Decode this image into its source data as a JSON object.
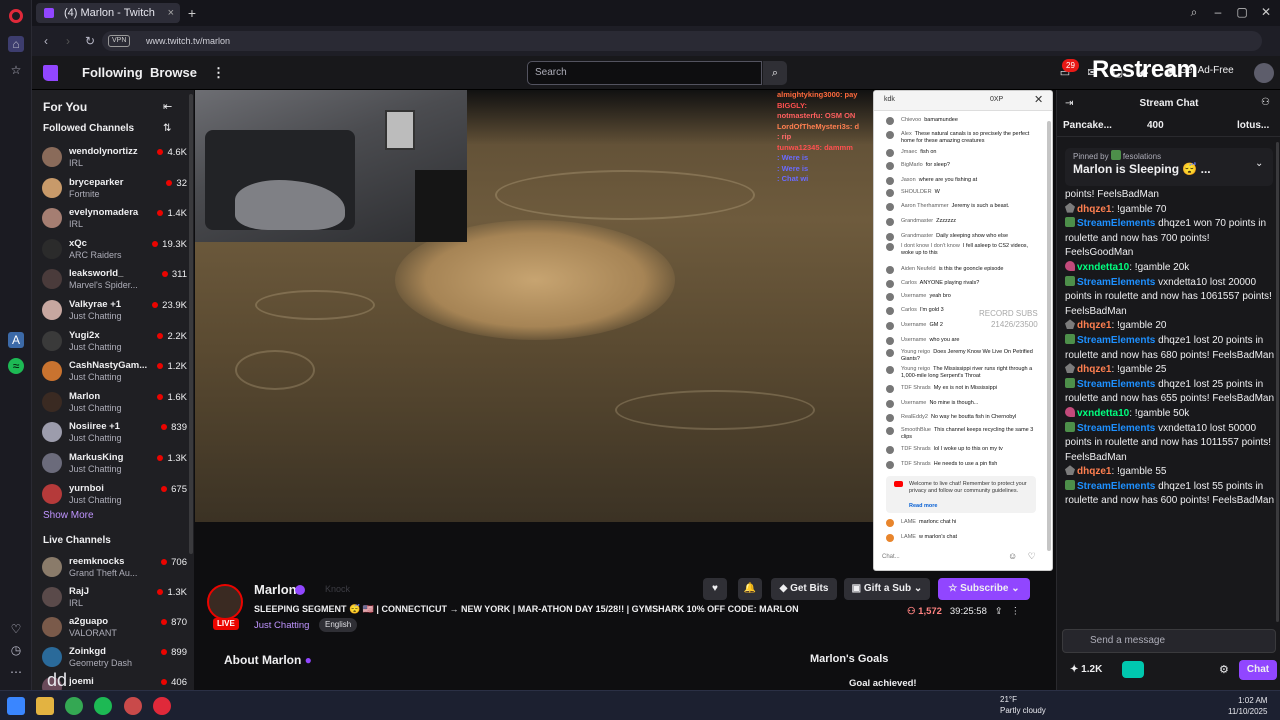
{
  "browser": {
    "tab_title": "(4) Marlon - Twitch",
    "new_tab": "+",
    "vpn": "VPN",
    "url": "www.twitch.tv/marlon"
  },
  "topnav": {
    "following": "Following",
    "browse": "Browse",
    "more": "⋮",
    "search_placeholder": "Search",
    "notification_count": "29",
    "get_adfree": "Get Ad-Free",
    "restream_logo": "Restream"
  },
  "sidebar": {
    "for_you": "For You",
    "followed_header": "Followed Channels",
    "show_more": "Show More",
    "live_channels_header": "Live Channels",
    "followed": [
      {
        "name": "wendolynortizz",
        "game": "IRL",
        "viewers": "4.6K",
        "color": "#8a6b5a"
      },
      {
        "name": "bryceparker",
        "game": "Fortnite",
        "viewers": "32",
        "color": "#c89a6a"
      },
      {
        "name": "evelynomadera",
        "game": "IRL",
        "viewers": "1.4K",
        "color": "#a57e72"
      },
      {
        "name": "xQc",
        "game": "ARC Raiders",
        "viewers": "19.3K",
        "color": "#2b2b2b"
      },
      {
        "name": "leaksworld_",
        "game": "Marvel's Spider...",
        "viewers": "311",
        "color": "#4a3b3b"
      },
      {
        "name": "Valkyrae +1",
        "game": "Just Chatting",
        "viewers": "23.9K",
        "color": "#c7a7a0"
      },
      {
        "name": "Yugi2x",
        "game": "Just Chatting",
        "viewers": "2.2K",
        "color": "#3a3a3a"
      },
      {
        "name": "CashNastyGam...",
        "game": "Just Chatting",
        "viewers": "1.2K",
        "color": "#c9732f"
      },
      {
        "name": "Marlon",
        "game": "Just Chatting",
        "viewers": "1.6K",
        "color": "#3a2a22"
      },
      {
        "name": "Nosiiree +1",
        "game": "Just Chatting",
        "viewers": "839",
        "color": "#9c9cac"
      },
      {
        "name": "MarkusKing",
        "game": "Just Chatting",
        "viewers": "1.3K",
        "color": "#6b6b7b"
      },
      {
        "name": "yurnboi",
        "game": "Just Chatting",
        "viewers": "675",
        "color": "#b53a3a"
      }
    ],
    "live": [
      {
        "name": "reemknocks",
        "game": "Grand Theft Au...",
        "viewers": "706",
        "color": "#8a7b6a"
      },
      {
        "name": "RajJ",
        "game": "IRL",
        "viewers": "1.3K",
        "color": "#5a4a4a"
      },
      {
        "name": "a2guapo",
        "game": "VALORANT",
        "viewers": "870",
        "color": "#7a5a4a"
      },
      {
        "name": "Zoinkgd",
        "game": "Geometry Dash",
        "viewers": "899",
        "color": "#2a6a9a"
      },
      {
        "name": "joemi",
        "game": "",
        "viewers": "406",
        "color": "#6a4a5a"
      }
    ]
  },
  "overlay_chat": [
    {
      "text": "almightyking3000: pay",
      "color": "#ff6a3d"
    },
    {
      "text": "BIGGLY:",
      "color": "#ff4f4f"
    },
    {
      "text": "notmasterfu: OSM ON",
      "color": "#ff5f5f"
    },
    {
      "text": "LordOfTheMysteri3s: d",
      "color": "#ff7f50"
    },
    {
      "text": ": rip",
      "color": "#ff6a6a"
    },
    {
      "text": "tunwa12345: dammm",
      "color": "#ff5050"
    },
    {
      "text": ": Were is",
      "color": "#6a6aff"
    },
    {
      "text": ": Were is",
      "color": "#6a6aff"
    },
    {
      "text": ": Chat wi",
      "color": "#6a6aff"
    }
  ],
  "popup_chat": {
    "header": "kdk",
    "header_right": "0XP",
    "close": "✕",
    "record_subs": "RECORD SUBS",
    "record_value": "21426/23500",
    "messages": [
      {
        "user": "Chievoo",
        "text": "bamamundee"
      },
      {
        "user": "Alex",
        "text": "These natural canals is so precisely the perfect home for these amazing creatures"
      },
      {
        "user": "Jmaec",
        "text": "fish on"
      },
      {
        "user": "BigMarlo",
        "text": "for sleep?"
      },
      {
        "user": "Jason",
        "text": "where are you fishing at"
      },
      {
        "user": "SHOULDER",
        "text": "W"
      },
      {
        "user": "Aaron Therhammer",
        "text": "Jeremy is such a beast."
      },
      {
        "user": "Grandmaster",
        "text": "Zzzzzzz"
      },
      {
        "user": "Grandmaster",
        "text": "Daily sleeping show who else"
      },
      {
        "user": "I dont know I don't know",
        "text": "I fell asleep to CS2 videos, woke up to this"
      },
      {
        "user": "Aiden Neufeld",
        "text": "is this the gooncle episode"
      },
      {
        "user": "Carlos",
        "text": "ANYONE playing rivals?"
      },
      {
        "user": "Username",
        "text": "yeah bro"
      },
      {
        "user": "Carlos",
        "text": "I'm gold 3"
      },
      {
        "user": "Username",
        "text": "GM 2"
      },
      {
        "user": "Username",
        "text": "who you are"
      },
      {
        "user": "Young reigo",
        "text": "Does Jeremy Know We Live On Petrified Giants?"
      },
      {
        "user": "Young reigo",
        "text": "The Mississippi river runs right through a 1,000-mile long Serpent's Throat"
      },
      {
        "user": "TDF Shrads",
        "text": "My ex is not in Mississippi"
      },
      {
        "user": "Username",
        "text": "No mine is though..."
      },
      {
        "user": "RealEddy2",
        "text": "No way he boutta fish in Chernobyl"
      },
      {
        "user": "SmoothBlue",
        "text": "This channel keeps recycling the same 3 clips"
      },
      {
        "user": "TDF Shrads",
        "text": "lol I woke up to this on my tv"
      },
      {
        "user": "TDF Shrads",
        "text": "He needs to use a pin fish"
      }
    ],
    "notice": "Welcome to live chat! Remember to protect your privacy and follow our community guidelines.",
    "read_more": "Read more",
    "late": [
      {
        "user": "LAME",
        "text": "marlonc chat hi"
      },
      {
        "user": "LAME",
        "text": "w marlon's chat"
      }
    ],
    "input_placeholder": "Chat..."
  },
  "stream": {
    "streamer": "Marlon",
    "knock": "Knock",
    "title": "SLEEPING SEGMENT 😴 🇺🇸 | CONNECTICUT → NEW YORK | MAR-ATHON DAY 15/28!! | GYMSHARK 10% OFF CODE: MARLON",
    "category": "Just Chatting",
    "language": "English",
    "live_badge": "LIVE",
    "viewer_count": "1,572",
    "uptime": "39:25:58",
    "get_bits": "Get Bits",
    "gift_sub": "Gift a Sub",
    "subscribe": "Subscribe",
    "about": "About Marlon",
    "goals": "Marlon's Goals",
    "goal_achieved": "Goal achieved!"
  },
  "chat": {
    "title": "Stream Chat",
    "hype_left": "Pancake...",
    "hype_left_count": "400",
    "hype_right": "lotus...",
    "pinned_by": "Pinned by",
    "pinned_by_user": "fesolations",
    "pinned_message": "Marlon is Sleeping 😴 ...",
    "input_placeholder": "Send a message",
    "points": "1.2K",
    "chat_button": "Chat",
    "lines": [
      {
        "badge": "none",
        "user": "",
        "user_color": "#efeff1",
        "text": "points! FeelsBadMan"
      },
      {
        "badge": "h",
        "user": "dhqze1",
        "user_color": "#ff7f50",
        "text": ": !gamble 70"
      },
      {
        "badge": "g",
        "user": "StreamElements",
        "user_color": "#1e90ff",
        "text": " dhqze1 won 70 points in roulette and now has 700 points! FeelsGoodMan"
      },
      {
        "badge": "p",
        "user": "vxndetta10",
        "user_color": "#00ff7f",
        "text": ": !gamble 20k"
      },
      {
        "badge": "g",
        "user": "StreamElements",
        "user_color": "#1e90ff",
        "text": " vxndetta10 lost 20000 points in roulette and now has 1061557 points! FeelsBadMan"
      },
      {
        "badge": "h",
        "user": "dhqze1",
        "user_color": "#ff7f50",
        "text": ": !gamble 20"
      },
      {
        "badge": "g",
        "user": "StreamElements",
        "user_color": "#1e90ff",
        "text": " dhqze1 lost 20 points in roulette and now has 680 points! FeelsBadMan"
      },
      {
        "badge": "h",
        "user": "dhqze1",
        "user_color": "#ff7f50",
        "text": ": !gamble 25"
      },
      {
        "badge": "g",
        "user": "StreamElements",
        "user_color": "#1e90ff",
        "text": " dhqze1 lost 25 points in roulette and now has 655 points! FeelsBadMan"
      },
      {
        "badge": "p",
        "user": "vxndetta10",
        "user_color": "#00ff7f",
        "text": ": !gamble 50k"
      },
      {
        "badge": "g",
        "user": "StreamElements",
        "user_color": "#1e90ff",
        "text": " vxndetta10 lost 50000 points in roulette and now has 1011557 points! FeelsBadMan"
      },
      {
        "badge": "h",
        "user": "dhqze1",
        "user_color": "#ff7f50",
        "text": ": !gamble 55"
      },
      {
        "badge": "g",
        "user": "StreamElements",
        "user_color": "#1e90ff",
        "text": " dhqze1 lost 55 points in roulette and now has 600 points! FeelsBadMan"
      }
    ]
  },
  "taskbar": {
    "temperature": "21°F",
    "weather": "Partly cloudy",
    "time": "1:02 AM",
    "date": "11/10/2025",
    "overlay_text": "dd"
  },
  "colors": {
    "twitch_purple": "#9146ff",
    "live_red": "#eb0400",
    "background": "#0e0e10"
  }
}
